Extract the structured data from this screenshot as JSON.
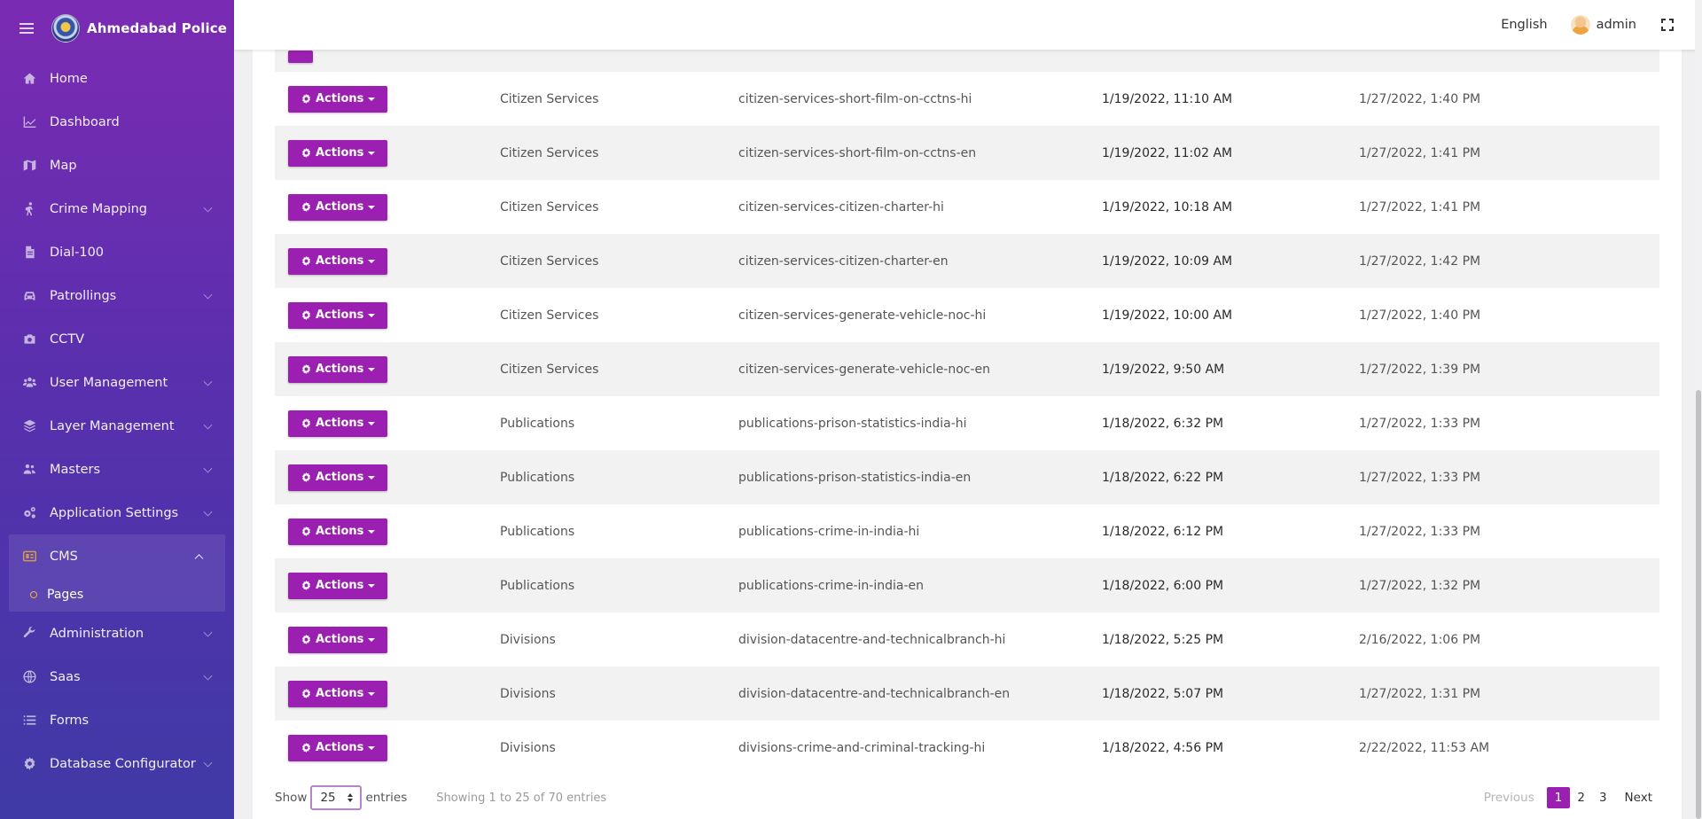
{
  "sidebar": {
    "brand": "Ahmedabad Police",
    "items": [
      {
        "label": "Home",
        "icon": "home-icon",
        "has_children": false
      },
      {
        "label": "Dashboard",
        "icon": "chart-line-icon",
        "has_children": false
      },
      {
        "label": "Map",
        "icon": "map-icon",
        "has_children": false
      },
      {
        "label": "Crime Mapping",
        "icon": "person-walking-icon",
        "has_children": true
      },
      {
        "label": "Dial-100",
        "icon": "document-icon",
        "has_children": false
      },
      {
        "label": "Patrollings",
        "icon": "car-icon",
        "has_children": true
      },
      {
        "label": "CCTV",
        "icon": "camera-icon",
        "has_children": false
      },
      {
        "label": "User Management",
        "icon": "users-icon",
        "has_children": true
      },
      {
        "label": "Layer Management",
        "icon": "layers-icon",
        "has_children": true
      },
      {
        "label": "Masters",
        "icon": "users-cog-icon",
        "has_children": true
      },
      {
        "label": "Application Settings",
        "icon": "cogs-icon",
        "has_children": true
      }
    ],
    "cms": {
      "label": "CMS",
      "icon": "cms-icon",
      "sub_items": [
        {
          "label": "Pages"
        }
      ]
    },
    "items_after": [
      {
        "label": "Administration",
        "icon": "wrench-icon",
        "has_children": true
      },
      {
        "label": "Saas",
        "icon": "globe-icon",
        "has_children": true
      },
      {
        "label": "Forms",
        "icon": "list-icon",
        "has_children": false
      },
      {
        "label": "Database Configurator",
        "icon": "gear-icon",
        "has_children": true
      }
    ]
  },
  "header": {
    "language": "English",
    "user": "admin",
    "fullscreen_icon": "expand-icon"
  },
  "table": {
    "action_label": "Actions",
    "rows": [
      {
        "category": "Citizen Services",
        "slug": "citizen-services-short-film-on-cctns-hi",
        "created": "1/19/2022, 11:10 AM",
        "updated": "1/27/2022, 1:40 PM"
      },
      {
        "category": "Citizen Services",
        "slug": "citizen-services-short-film-on-cctns-en",
        "created": "1/19/2022, 11:02 AM",
        "updated": "1/27/2022, 1:41 PM"
      },
      {
        "category": "Citizen Services",
        "slug": "citizen-services-citizen-charter-hi",
        "created": "1/19/2022, 10:18 AM",
        "updated": "1/27/2022, 1:41 PM"
      },
      {
        "category": "Citizen Services",
        "slug": "citizen-services-citizen-charter-en",
        "created": "1/19/2022, 10:09 AM",
        "updated": "1/27/2022, 1:42 PM"
      },
      {
        "category": "Citizen Services",
        "slug": "citizen-services-generate-vehicle-noc-hi",
        "created": "1/19/2022, 10:00 AM",
        "updated": "1/27/2022, 1:40 PM"
      },
      {
        "category": "Citizen Services",
        "slug": "citizen-services-generate-vehicle-noc-en",
        "created": "1/19/2022, 9:50 AM",
        "updated": "1/27/2022, 1:39 PM"
      },
      {
        "category": "Publications",
        "slug": "publications-prison-statistics-india-hi",
        "created": "1/18/2022, 6:32 PM",
        "updated": "1/27/2022, 1:33 PM"
      },
      {
        "category": "Publications",
        "slug": "publications-prison-statistics-india-en",
        "created": "1/18/2022, 6:22 PM",
        "updated": "1/27/2022, 1:33 PM"
      },
      {
        "category": "Publications",
        "slug": "publications-crime-in-india-hi",
        "created": "1/18/2022, 6:12 PM",
        "updated": "1/27/2022, 1:33 PM"
      },
      {
        "category": "Publications",
        "slug": "publications-crime-in-india-en",
        "created": "1/18/2022, 6:00 PM",
        "updated": "1/27/2022, 1:32 PM"
      },
      {
        "category": "Divisions",
        "slug": "division-datacentre-and-technicalbranch-hi",
        "created": "1/18/2022, 5:25 PM",
        "updated": "2/16/2022, 1:06 PM"
      },
      {
        "category": "Divisions",
        "slug": "division-datacentre-and-technicalbranch-en",
        "created": "1/18/2022, 5:07 PM",
        "updated": "1/27/2022, 1:31 PM"
      },
      {
        "category": "Divisions",
        "slug": "divisions-crime-and-criminal-tracking-hi",
        "created": "1/18/2022, 4:56 PM",
        "updated": "2/22/2022, 11:53 AM"
      }
    ]
  },
  "footer": {
    "show_label": "Show",
    "page_length": "25",
    "entries_label": "entries",
    "info": "Showing 1 to 25 of 70 entries",
    "previous": "Previous",
    "pages": [
      "1",
      "2",
      "3"
    ],
    "active_page": "1",
    "next": "Next"
  },
  "colors": {
    "accent": "#9b1fb0",
    "sidebar_top": "#7b2bb3",
    "sidebar_bottom": "#3f3aa6",
    "submenu_dot": "#f4b631"
  }
}
